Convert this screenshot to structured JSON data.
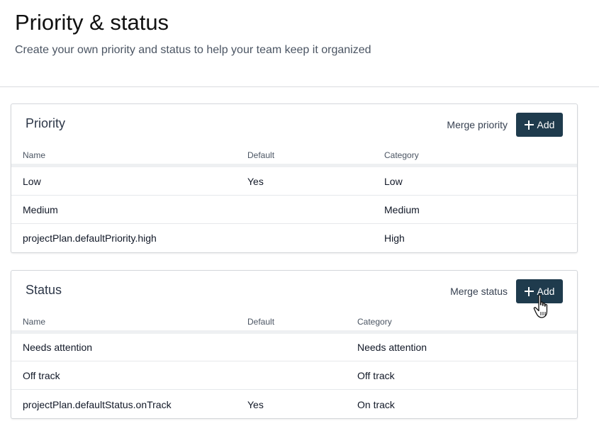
{
  "header": {
    "title": "Priority & status",
    "subtitle": "Create your own priority and status to help your team keep it organized"
  },
  "priority": {
    "title": "Priority",
    "merge_label": "Merge priority",
    "add_label": "Add",
    "columns": [
      "Name",
      "Default",
      "Category"
    ],
    "rows": [
      {
        "name": "Low",
        "default": "Yes",
        "category": "Low"
      },
      {
        "name": "Medium",
        "default": "",
        "category": "Medium"
      },
      {
        "name": "projectPlan.defaultPriority.high",
        "default": "",
        "category": "High"
      }
    ]
  },
  "status": {
    "title": "Status",
    "merge_label": "Merge status",
    "add_label": "Add",
    "columns": [
      "Name",
      "Default",
      "Category"
    ],
    "rows": [
      {
        "name": "Needs attention",
        "default": "",
        "category": "Needs attention"
      },
      {
        "name": "Off track",
        "default": "",
        "category": "Off track"
      },
      {
        "name": "projectPlan.defaultStatus.onTrack",
        "default": "Yes",
        "category": "On track"
      }
    ]
  },
  "colors": {
    "button_bg": "#1f3b4d",
    "divider": "#d9dcdf"
  },
  "icons": {
    "add": "plus-icon",
    "cursor": "hand-pointer-icon"
  }
}
